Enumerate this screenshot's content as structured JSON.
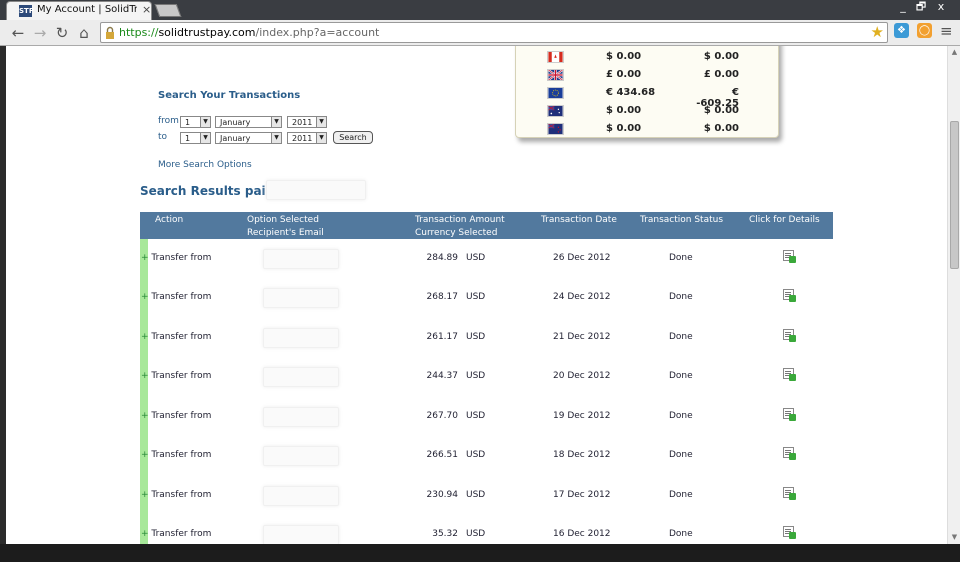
{
  "browser": {
    "tab_title": "My Account | SolidTrust P",
    "tab_favicon": "STP",
    "tab_close": "×",
    "url_scheme": "https://",
    "url_host": "solidtrustpay.com",
    "url_path": "/index.php?a=account",
    "win_minimize": "_",
    "win_restore": "🗗",
    "win_close": "x"
  },
  "balances": [
    {
      "flag": "canada-flag-icon",
      "col1": "$ 0.00",
      "col2": "$ 0.00"
    },
    {
      "flag": "uk-flag-icon",
      "col1": "£ 0.00",
      "col2": "£ 0.00"
    },
    {
      "flag": "eu-flag-icon",
      "col1": "€ 434.68",
      "col2": "€ -609.25"
    },
    {
      "flag": "australia-flag-icon",
      "col1": "$ 0.00",
      "col2": "$ 0.00"
    },
    {
      "flag": "newzealand-flag-icon",
      "col1": "$ 0.00",
      "col2": "$ 0.00"
    }
  ],
  "search": {
    "heading": "Search Your Transactions",
    "from_label": "from",
    "to_label": "to",
    "from_day": "1",
    "from_month": "January",
    "from_year": "2011",
    "to_day": "1",
    "to_month": "January",
    "to_year": "2011",
    "button": "Search",
    "more_options": "More Search Options"
  },
  "results": {
    "title": "Search Results paid by",
    "columns": {
      "action": "Action",
      "option_selected": "Option Selected",
      "recipient_email": "Recipient's Email",
      "amount": "Transaction Amount",
      "currency": "Currency Selected",
      "date": "Transaction Date",
      "status": "Transaction Status",
      "details": "Click for Details"
    },
    "rows": [
      {
        "action": "Transfer from",
        "amount": "284.89",
        "currency": "USD",
        "date": "26 Dec 2012",
        "status": "Done"
      },
      {
        "action": "Transfer from",
        "amount": "268.17",
        "currency": "USD",
        "date": "24 Dec 2012",
        "status": "Done"
      },
      {
        "action": "Transfer from",
        "amount": "261.17",
        "currency": "USD",
        "date": "21 Dec 2012",
        "status": "Done"
      },
      {
        "action": "Transfer from",
        "amount": "244.37",
        "currency": "USD",
        "date": "20 Dec 2012",
        "status": "Done"
      },
      {
        "action": "Transfer from",
        "amount": "267.70",
        "currency": "USD",
        "date": "19 Dec 2012",
        "status": "Done"
      },
      {
        "action": "Transfer from",
        "amount": "266.51",
        "currency": "USD",
        "date": "18 Dec 2012",
        "status": "Done"
      },
      {
        "action": "Transfer from",
        "amount": "230.94",
        "currency": "USD",
        "date": "17 Dec 2012",
        "status": "Done"
      },
      {
        "action": "Transfer from",
        "amount": "35.32",
        "currency": "USD",
        "date": "16 Dec 2012",
        "status": "Done"
      }
    ]
  },
  "colors": {
    "header_bg": "#52799e",
    "link_blue": "#2a5d8a",
    "green_bar": "#a8e89a"
  }
}
